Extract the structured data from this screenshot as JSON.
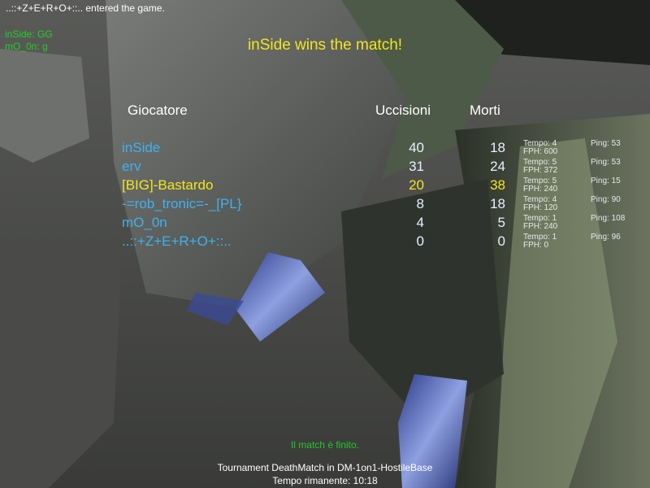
{
  "console": {
    "message": "..::+Z+E+R+O+::.. entered the game."
  },
  "chat": [
    {
      "text": "inSide: GG"
    },
    {
      "text": "mO_0n: g"
    }
  ],
  "banner": {
    "text": "inSide wins the match!"
  },
  "scoreboard": {
    "headers": {
      "player": "Giocatore",
      "kills": "Uccisioni",
      "deaths": "Morti"
    },
    "rows": [
      {
        "name": "inSide",
        "kills": "40",
        "deaths": "18",
        "tempo": "Tempo: 4",
        "fph": "FPH: 600",
        "ping": "Ping: 53"
      },
      {
        "name": "erv",
        "kills": "31",
        "deaths": "24",
        "tempo": "Tempo: 5",
        "fph": "FPH: 372",
        "ping": "Ping: 53"
      },
      {
        "name": "[BIG]-Bastardo",
        "kills": "20",
        "deaths": "38",
        "tempo": "Tempo: 5",
        "fph": "FPH: 240",
        "ping": "Ping: 15"
      },
      {
        "name": "-=rob_tronic=-_[PL}",
        "kills": "8",
        "deaths": "18",
        "tempo": "Tempo: 4",
        "fph": "FPH: 120",
        "ping": "Ping: 90"
      },
      {
        "name": "mO_0n",
        "kills": "4",
        "deaths": "5",
        "tempo": "Tempo: 1",
        "fph": "FPH: 240",
        "ping": "Ping: 108"
      },
      {
        "name": "..::+Z+E+R+O+::..",
        "kills": "0",
        "deaths": "0",
        "tempo": "Tempo: 1",
        "fph": "FPH: 0",
        "ping": "Ping: 96"
      }
    ]
  },
  "footer": {
    "ended": "Il match è finito.",
    "gameinfo": "Tournament DeathMatch in DM-1on1-HostileBase",
    "timeleft": "Tempo rimanente:  10:18"
  },
  "colors": {
    "console_text": "#ffffff",
    "chat_text": "#22d022",
    "banner_text": "#f2e61c",
    "player_blue": "#3fb2f0",
    "self_highlight": "#f2e61c",
    "score_white": "#e8f0ff",
    "ended_text": "#22c822"
  },
  "highlight_row_index": 2
}
